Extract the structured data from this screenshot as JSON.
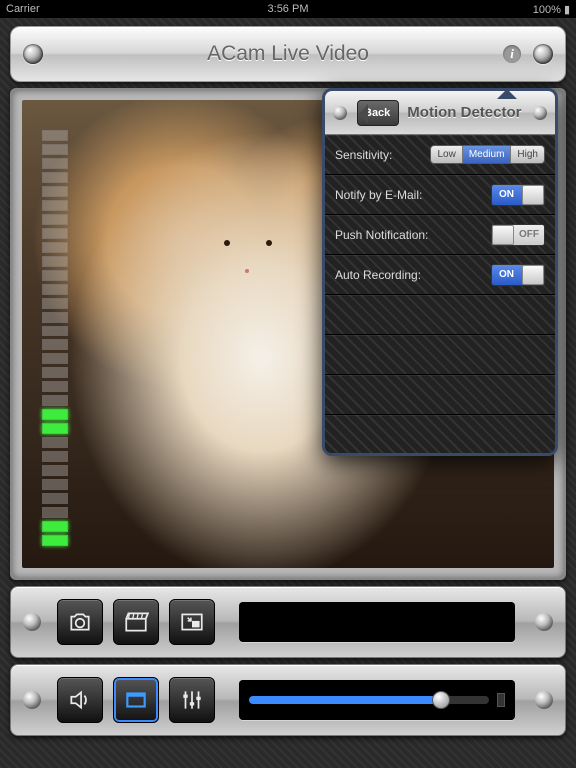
{
  "status": {
    "carrier": "Carrier",
    "time": "3:56 PM",
    "battery": "100%"
  },
  "header": {
    "title": "ACam Live Video"
  },
  "vu": {
    "segments": 30,
    "active": [
      0,
      1,
      8,
      9
    ]
  },
  "popover": {
    "back": "Back",
    "title": "Motion Detector",
    "sensitivity": {
      "label": "Sensitivity:",
      "options": [
        "Low",
        "Medium",
        "High"
      ],
      "selected": "Medium"
    },
    "notify_email": {
      "label": "Notify by E-Mail:",
      "value": "ON"
    },
    "push": {
      "label": "Push Notification:",
      "value": "OFF"
    },
    "auto_record": {
      "label": "Auto Recording:",
      "value": "ON"
    }
  },
  "toolbar1": {
    "buttons": [
      "camera",
      "clapper",
      "pip"
    ]
  },
  "toolbar2": {
    "buttons": [
      "speaker",
      "overlay",
      "equalizer"
    ],
    "active": "overlay",
    "slider": 0.8
  }
}
